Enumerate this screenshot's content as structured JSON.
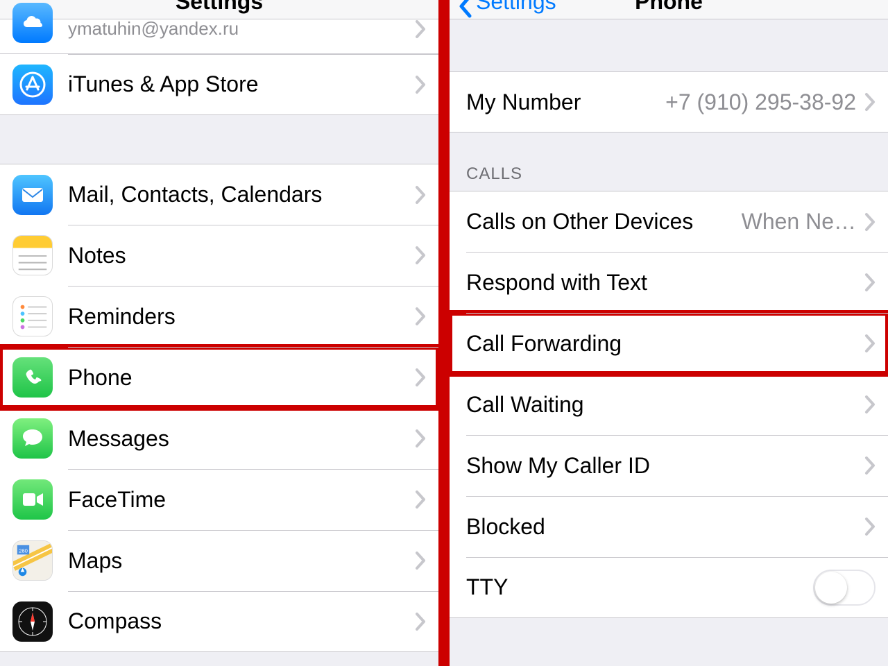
{
  "left": {
    "title": "Settings",
    "email": "ymatuhin@yandex.ru",
    "items": {
      "itunes": "iTunes & App Store",
      "mail": "Mail, Contacts, Calendars",
      "notes": "Notes",
      "reminders": "Reminders",
      "phone": "Phone",
      "messages": "Messages",
      "facetime": "FaceTime",
      "maps": "Maps",
      "compass": "Compass"
    }
  },
  "right": {
    "back": "Settings",
    "title": "Phone",
    "my_number_label": "My Number",
    "my_number_value": "+7 (910) 295-38-92",
    "calls_header": "CALLS",
    "items": {
      "other_devices": "Calls on Other Devices",
      "other_devices_value": "When Ne…",
      "respond": "Respond with Text",
      "call_forwarding": "Call Forwarding",
      "call_waiting": "Call Waiting",
      "caller_id": "Show My Caller ID",
      "blocked": "Blocked",
      "tty": "TTY"
    }
  }
}
